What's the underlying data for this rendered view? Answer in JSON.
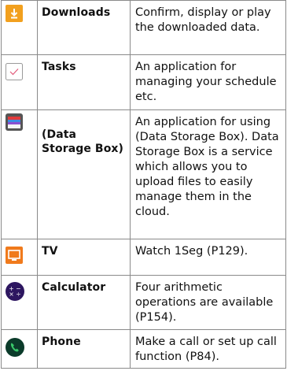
{
  "rows": [
    {
      "icon": "download-icon",
      "name": "Downloads",
      "desc": "Confirm, display or play the downloaded data."
    },
    {
      "icon": "tasks-checkmark-icon",
      "name": "Tasks",
      "desc": "An application for managing your schedule etc."
    },
    {
      "icon": "data-storage-box-icon",
      "name": "(Data Storage Box)",
      "desc": "An application for using  (Data Storage Box). Data Storage Box is a service which allows you to upload files to easily manage them in the cloud."
    },
    {
      "icon": "tv-icon",
      "name": "TV",
      "desc": "Watch 1Seg (P129)."
    },
    {
      "icon": "calculator-icon",
      "name": "Calculator",
      "desc": "Four arithmetic operations are available (P154)."
    },
    {
      "icon": "phone-icon",
      "name": "Phone",
      "desc": "Make a call or set up call function (P84)."
    }
  ],
  "colors": {
    "download": "#f2a01e",
    "tv": "#f07a1c",
    "calculator": "#2d1660",
    "phone": "#0b3b2a",
    "border": "#8a8a8a"
  }
}
